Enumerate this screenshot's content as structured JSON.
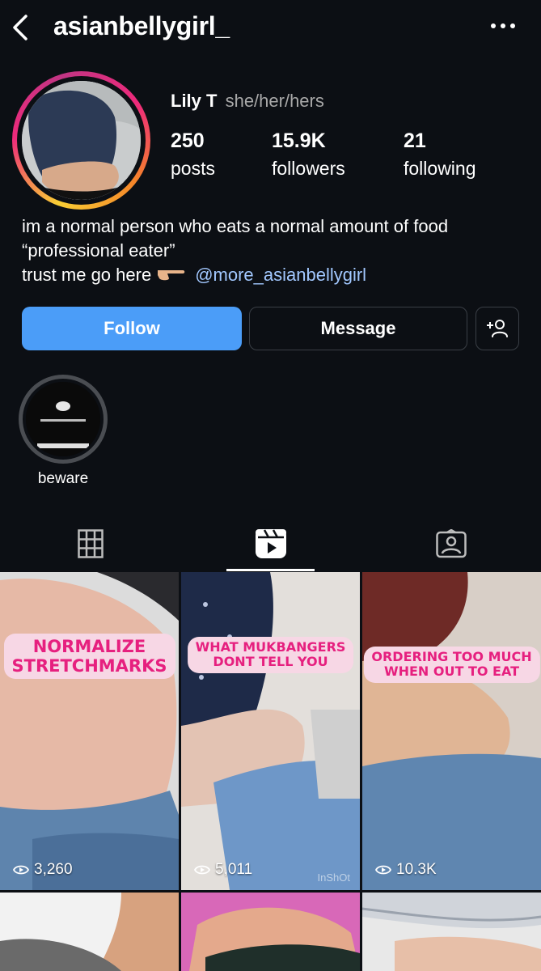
{
  "header": {
    "username": "asianbellygirl_",
    "back_icon": "chevron-left-icon",
    "more_icon": "more-horizontal-icon"
  },
  "profile": {
    "name": "Lily T",
    "pronouns": "she/her/hers",
    "stats": [
      {
        "value": "250",
        "label": "posts"
      },
      {
        "value": "15.9K",
        "label": "followers"
      },
      {
        "value": "21",
        "label": "following"
      }
    ],
    "bio": {
      "line1": "im a normal person who eats a normal amount of food",
      "line2": "“professional eater”",
      "line3": "trust me go here",
      "link": "@more_asianbellygirl"
    }
  },
  "actions": {
    "follow_label": "Follow",
    "message_label": "Message",
    "add_user_icon": "add-user-icon"
  },
  "highlights": [
    {
      "label": "beware"
    }
  ],
  "tabs": [
    {
      "icon": "grid-icon",
      "active": false
    },
    {
      "icon": "reels-icon",
      "active": true
    },
    {
      "icon": "tagged-icon",
      "active": false
    }
  ],
  "reels": [
    {
      "overlay_line1": "NORMALIZE",
      "overlay_line2": "STRETCHMARKS",
      "views": "3,260"
    },
    {
      "overlay_line1": "WHAT MUKBANGERS",
      "overlay_line2": "DONT TELL YOU",
      "views": "5,011",
      "watermark": "InShOt"
    },
    {
      "overlay_line1": "ORDERING TOO MUCH",
      "overlay_line2": "WHEN OUT TO EAT",
      "views": "10.3K"
    }
  ],
  "colors": {
    "background": "#0c0f14",
    "follow_button": "#4b9df8",
    "link": "#a2c8ff",
    "overlay_pink": "#e6207f",
    "overlay_bg": "#f7d7e5"
  }
}
